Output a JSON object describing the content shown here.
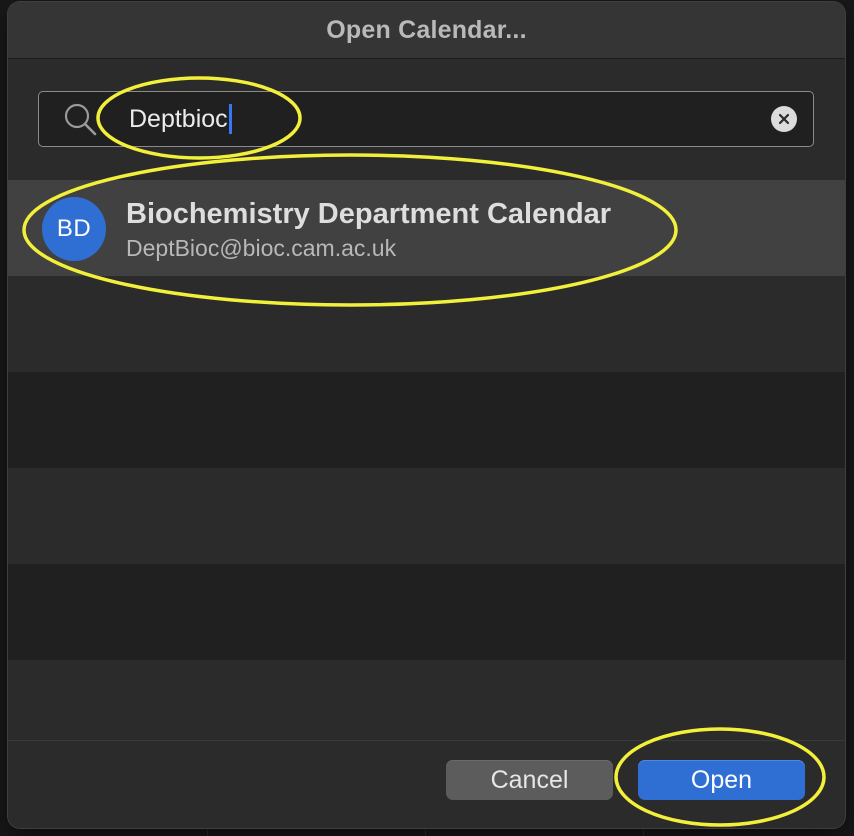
{
  "dialog": {
    "title": "Open Calendar..."
  },
  "search": {
    "value": "Deptbioc",
    "icon": "search-icon",
    "clear_icon": "clear-icon"
  },
  "results": [
    {
      "initials": "BD",
      "name": "Biochemistry Department Calendar",
      "email": "DeptBioc@bioc.cam.ac.uk",
      "selected": true
    }
  ],
  "buttons": {
    "cancel_label": "Cancel",
    "open_label": "Open"
  },
  "colors": {
    "accent": "#2f6fd3",
    "annotation": "#f2f03a",
    "caret": "#3478f6"
  }
}
